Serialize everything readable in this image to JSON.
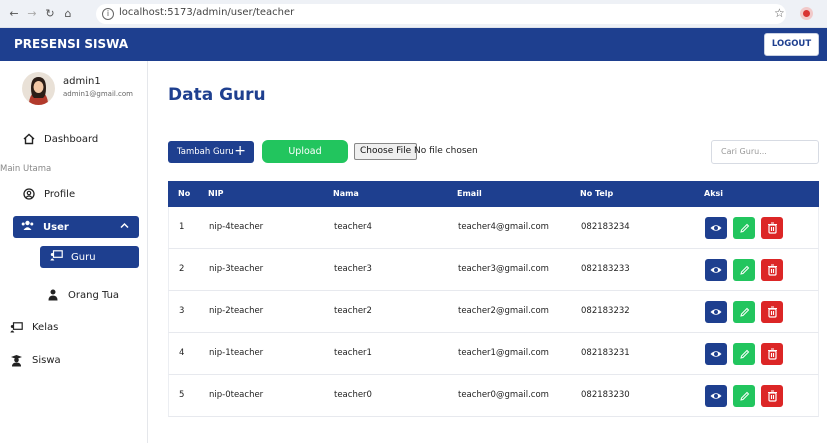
{
  "browser": {
    "url": "localhost:5173/admin/user/teacher"
  },
  "header": {
    "brand": "PRESENSI SISWA",
    "logout_label": "LOGOUT"
  },
  "sidebar": {
    "user_name": "admin1",
    "user_email": "admin1@gmail.com",
    "dashboard": "Dashboard",
    "section_label": "Main Utama",
    "profile": "Profile",
    "user": "User",
    "guru": "Guru",
    "orang_tua": "Orang Tua",
    "kelas": "Kelas",
    "siswa": "Siswa"
  },
  "main": {
    "title": "Data Guru",
    "add_label": "Tambah Guru",
    "upload_label": "Upload",
    "file_button": "Choose File",
    "file_status": "No file chosen",
    "search_placeholder": "Cari Guru..."
  },
  "table": {
    "headers": [
      "No",
      "NIP",
      "Nama",
      "Email",
      "No Telp",
      "Aksi"
    ],
    "rows": [
      {
        "no": "1",
        "nip": "nip-4teacher",
        "nama": "teacher4",
        "email": "teacher4@gmail.com",
        "telp": "082183234"
      },
      {
        "no": "2",
        "nip": "nip-3teacher",
        "nama": "teacher3",
        "email": "teacher3@gmail.com",
        "telp": "082183233"
      },
      {
        "no": "3",
        "nip": "nip-2teacher",
        "nama": "teacher2",
        "email": "teacher2@gmail.com",
        "telp": "082183232"
      },
      {
        "no": "4",
        "nip": "nip-1teacher",
        "nama": "teacher1",
        "email": "teacher1@gmail.com",
        "telp": "082183231"
      },
      {
        "no": "5",
        "nip": "nip-0teacher",
        "nama": "teacher0",
        "email": "teacher0@gmail.com",
        "telp": "082183230"
      }
    ]
  },
  "colors": {
    "primary": "#1e3f8f",
    "success": "#22c55e",
    "danger": "#dc2626"
  }
}
